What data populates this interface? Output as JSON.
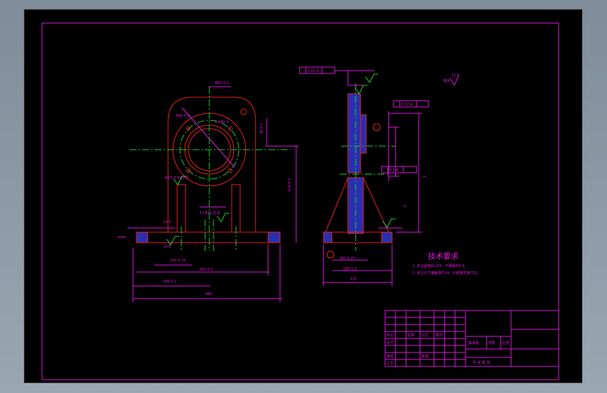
{
  "drawing": {
    "tech_title": "技术要求",
    "tech_notes": [
      "1. 未注圆角R2-R3，不锈钢件0.5。",
      "2. 未注尺寸偏差按IT14，不锈钢件按IT12."
    ],
    "dims": {
      "bottom_total": "380",
      "phi_top": "Φ62 0.1",
      "phi_80": "Φ80 0.3",
      "phi_54": "4×Φ5.4",
      "tb_name": "轴承座",
      "tb_scale": "比例",
      "tb_qty": "件数",
      "tb_sheet": "共 张 第 张"
    },
    "colors": {
      "background": "#000000",
      "frame": "#e015e0",
      "outline": "#e8211c",
      "centerline": "#1bd12a",
      "section": "#2a2fb0"
    }
  }
}
